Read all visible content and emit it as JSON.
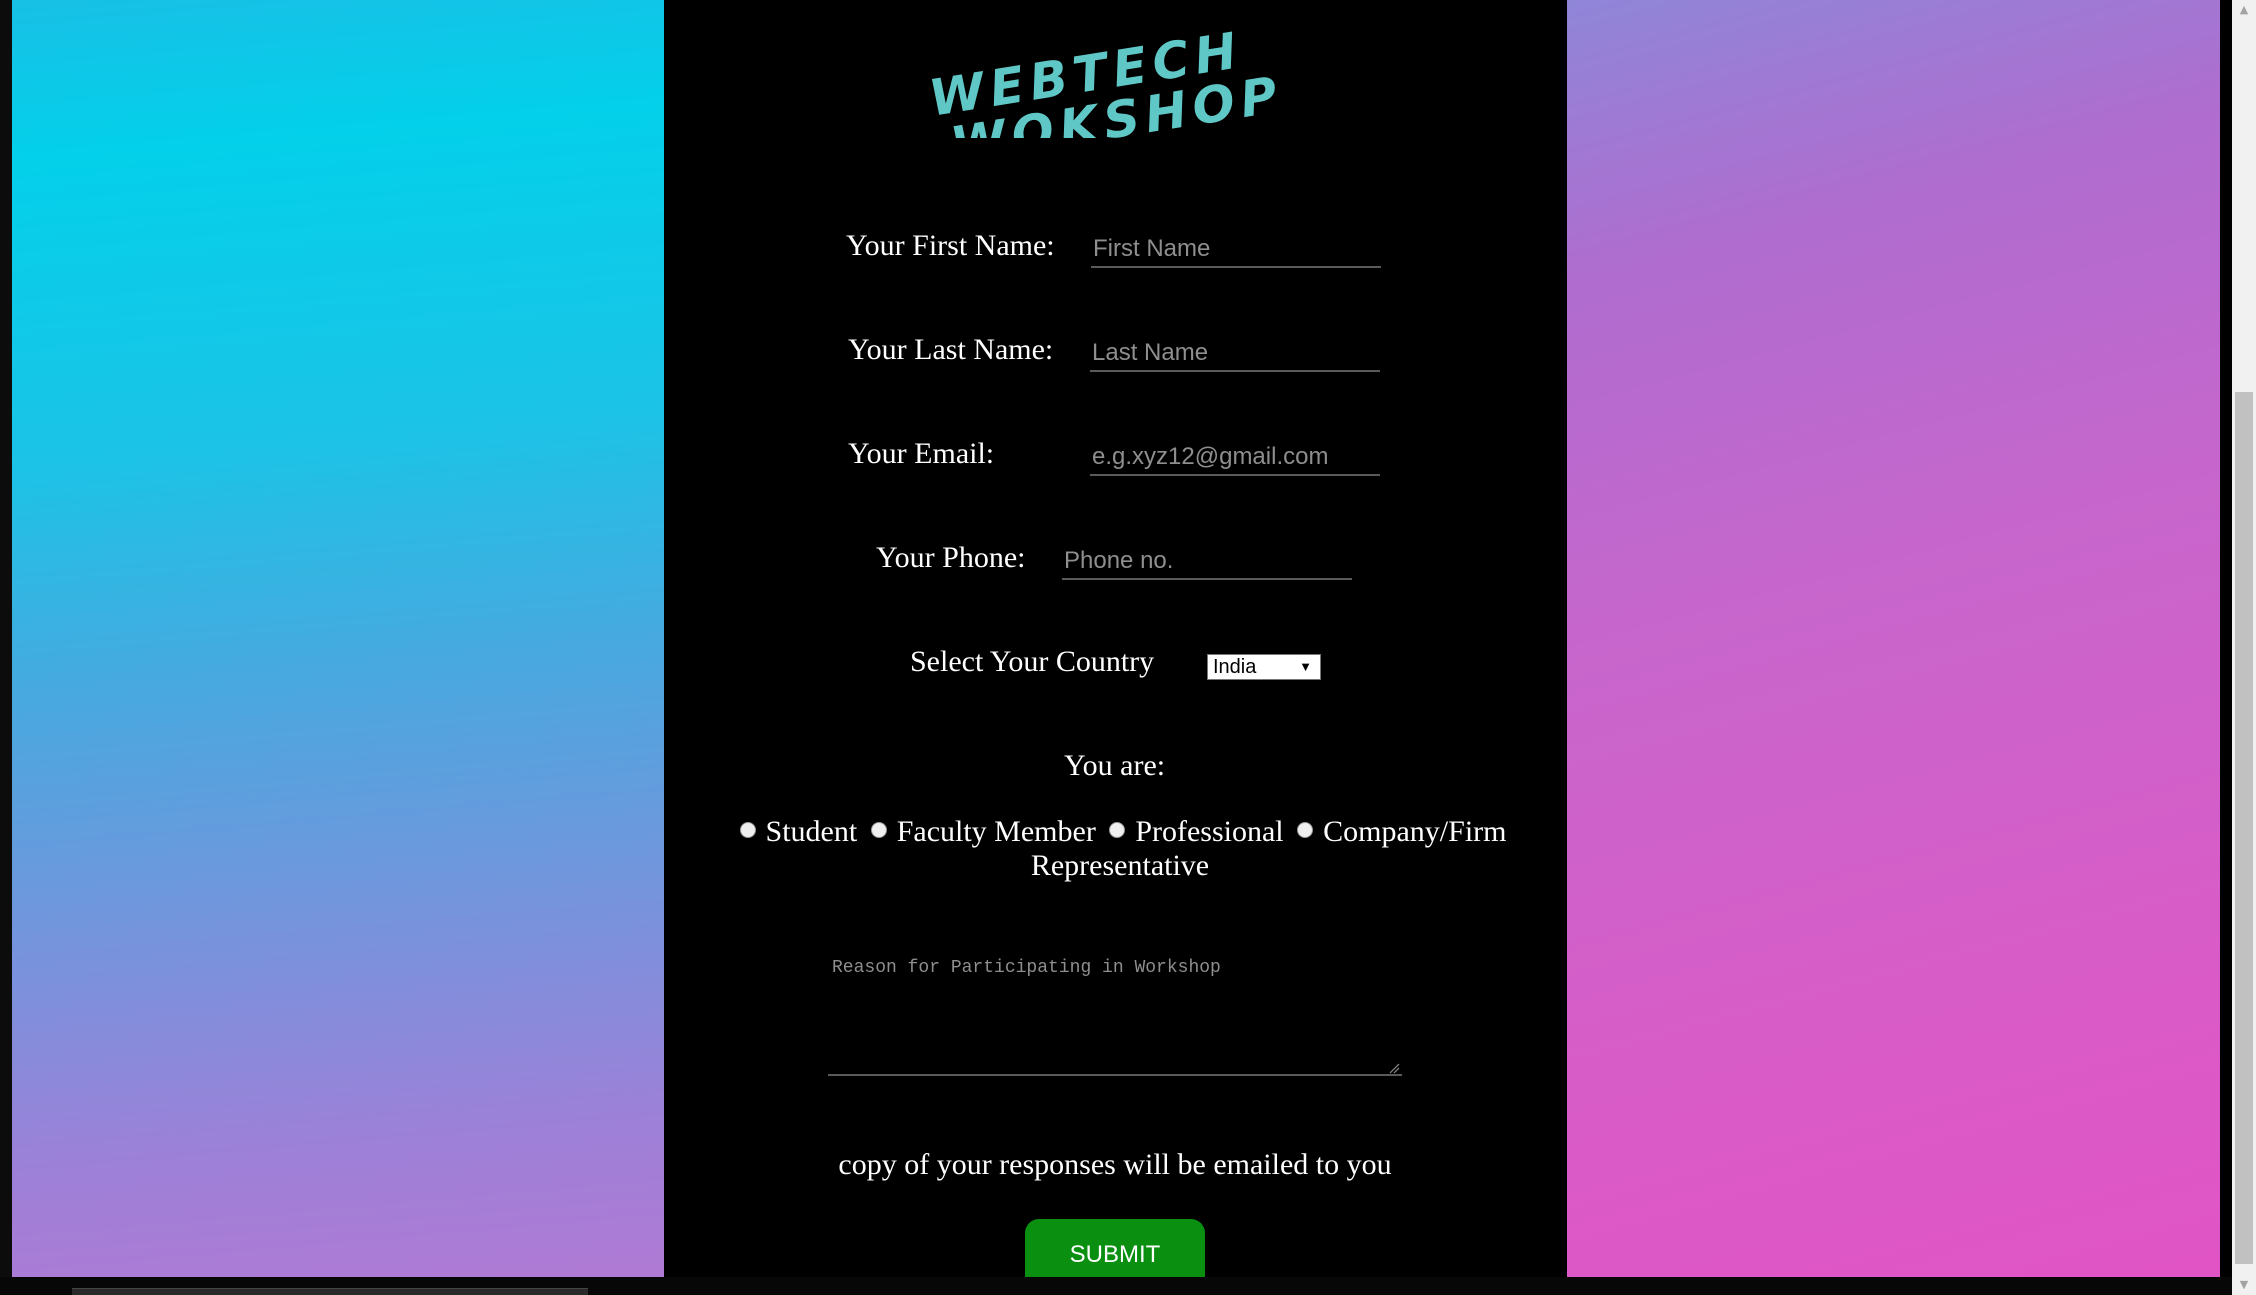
{
  "logo": {
    "line1": "WEBTECH",
    "line2": "WOKSHOP",
    "color": "#5fc8c6"
  },
  "form": {
    "first_name": {
      "label": "Your First Name:",
      "placeholder": "First Name",
      "value": ""
    },
    "last_name": {
      "label": "Your Last Name:",
      "placeholder": "Last Name",
      "value": ""
    },
    "email": {
      "label": "Your Email:",
      "placeholder": "e.g.xyz12@gmail.com",
      "value": ""
    },
    "phone": {
      "label": "Your Phone:",
      "placeholder": "Phone no.",
      "value": ""
    },
    "country": {
      "label": "Select Your Country",
      "selected": "India"
    },
    "role": {
      "label": "You are:",
      "options": [
        "Student",
        "Faculty Member",
        "Professional",
        "Company/Firm Representative"
      ]
    },
    "reason": {
      "placeholder": "Reason for Participating in Workshop",
      "value": ""
    },
    "note": "copy of your responses will be emailed to you",
    "submit_label": "SUBMIT"
  },
  "colors": {
    "submit_button": "#0a8f10",
    "center_background": "#000000",
    "left_gradient": [
      "#03d0ea",
      "#b07ad4"
    ],
    "right_gradient": [
      "#8f86d8",
      "#e154c6"
    ]
  }
}
